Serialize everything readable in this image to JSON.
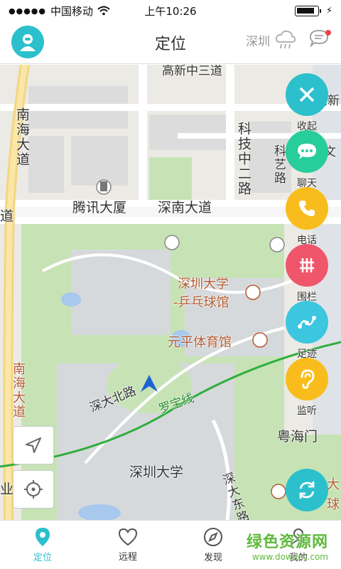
{
  "status_bar": {
    "carrier": "中国移动",
    "time": "上午10:26"
  },
  "nav": {
    "title": "定位",
    "city": "深圳"
  },
  "map": {
    "labels": {
      "tencent": "腾讯大厦",
      "shennan": "深南大道",
      "nanhai_top": "南海大道",
      "nanhai_bottom": "南海大道",
      "keji": "科技中二路",
      "keyi": "科艺路",
      "szu_pingpong_1": "深圳大学",
      "szu_pingpong_2": "-乒乓球馆",
      "yuanping": "元平体育馆",
      "shenda_north": "深大北路",
      "luobao": "罗宝线",
      "szu": "深圳大学",
      "yuehai": "粤海门",
      "shenda_east": "深大东路",
      "dao_left": "道",
      "ye_left": "业",
      "gaoxin_top": "高新",
      "wen_right": "文",
      "da_right": "大",
      "qiu_right": "球",
      "top_road": "高新中三道"
    }
  },
  "fabs": [
    {
      "label": "收起",
      "color": "#2cc0cc",
      "icon": "close-icon"
    },
    {
      "label": "聊天",
      "color": "#27cd9a",
      "icon": "chat-icon"
    },
    {
      "label": "电话",
      "color": "#f8bd1c",
      "icon": "phone-icon"
    },
    {
      "label": "围栏",
      "color": "#f0566b",
      "icon": "fence-icon"
    },
    {
      "label": "足迹",
      "color": "#3cc6e0",
      "icon": "footprint-icon"
    },
    {
      "label": "监听",
      "color": "#f8bd1c",
      "icon": "ear-icon"
    }
  ],
  "tabs": [
    {
      "label": "定位",
      "active": true,
      "icon": "location-pin-icon"
    },
    {
      "label": "远程",
      "active": false,
      "icon": "heart-icon"
    },
    {
      "label": "发现",
      "active": false,
      "icon": "compass-icon"
    },
    {
      "label": "我的",
      "active": false,
      "icon": "profile-icon"
    }
  ],
  "watermark": {
    "title": "绿色资源网",
    "url": "www.downcc.com"
  },
  "colors": {
    "accent": "#2cc0cc",
    "map_green": "#c7e3b5",
    "map_bg": "#eceae4"
  }
}
